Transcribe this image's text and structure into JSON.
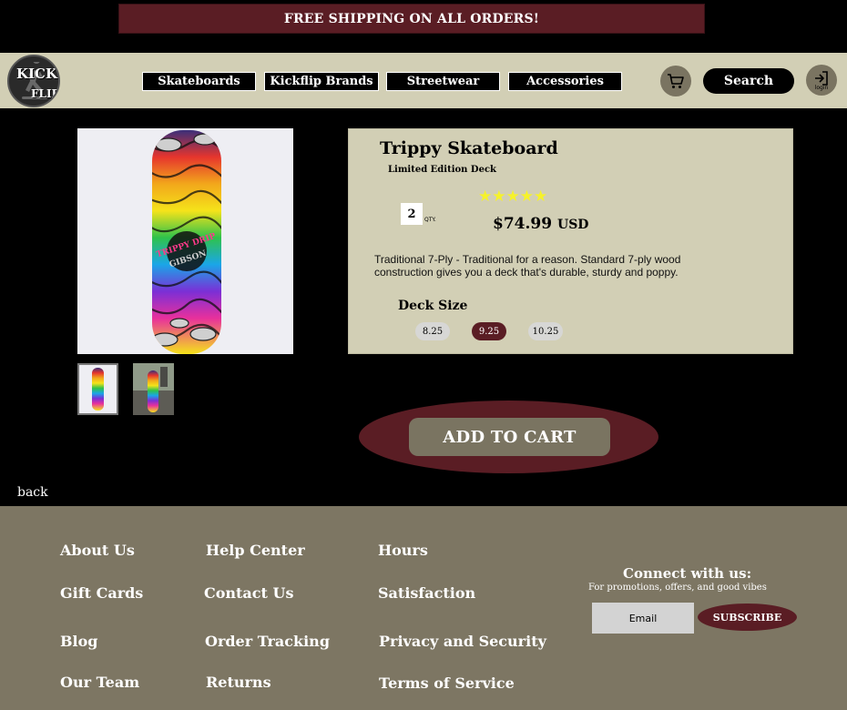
{
  "promo_banner": {
    "text": "FREE SHIPPING ON ALL ORDERS!"
  },
  "header": {
    "logo": {
      "line1": "KICK",
      "line2": "FLIP"
    },
    "nav": [
      {
        "label": "Skateboards"
      },
      {
        "label": "Kickflip Brands"
      },
      {
        "label": "Streetwear"
      },
      {
        "label": "Accessories"
      }
    ],
    "cart_icon": "shopping-cart-icon",
    "search_label": "Search",
    "login": {
      "icon": "login-arrow-icon",
      "label": "login"
    }
  },
  "product": {
    "title": "Trippy Skateboard",
    "subtitle": "Limited Edition Deck",
    "quantity": "2",
    "quantity_label": "QTY.",
    "rating": 5,
    "rating_stars": "★★★★★",
    "price": "$74.99",
    "currency": "USD",
    "description": "Traditional 7-Ply - Traditional for a reason. Standard 7-ply wood construction gives you a deck that's durable, sturdy and poppy.",
    "deck_size_label": "Deck Size",
    "sizes": [
      {
        "label": "8.25",
        "selected": false
      },
      {
        "label": "9.25",
        "selected": true
      },
      {
        "label": "10.25",
        "selected": false
      }
    ],
    "add_to_cart_label": "ADD TO CART",
    "deck_graphic_text": [
      "TRIPPY DRIP",
      "GIBSON"
    ]
  },
  "back_label": "back",
  "footer": {
    "columns": [
      [
        "About Us",
        "Gift Cards",
        "Blog",
        "Our Team"
      ],
      [
        "Help Center",
        "Contact Us",
        "Order Tracking",
        "Returns"
      ],
      [
        "Hours",
        "Satisfaction",
        "Privacy and Security",
        "Terms of Service"
      ]
    ],
    "connect_title": "Connect with us:",
    "connect_subtitle": "For promotions, offers, and good vibes",
    "email_placeholder": "Email",
    "subscribe_label": "SUBSCRIBE"
  },
  "colors": {
    "accent_maroon": "#5a1d24",
    "header_bg": "#d2cfb5",
    "footer_bg": "#7d7663",
    "button_taupe": "#7a7461",
    "star_yellow": "#f6f22a"
  }
}
